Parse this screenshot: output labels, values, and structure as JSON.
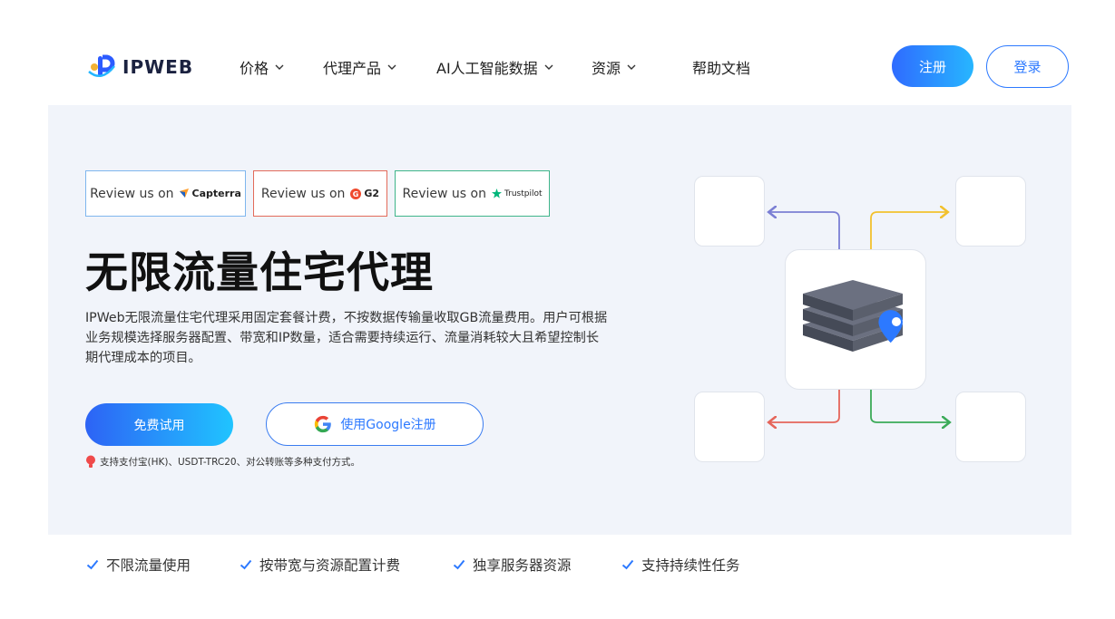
{
  "header": {
    "logo_text": "IPWEB",
    "nav": [
      {
        "label": "价格",
        "has_dropdown": true
      },
      {
        "label": "代理产品",
        "has_dropdown": true
      },
      {
        "label": "AI人工智能数据",
        "has_dropdown": true
      },
      {
        "label": "资源",
        "has_dropdown": true
      },
      {
        "label": "帮助文档",
        "has_dropdown": false
      }
    ],
    "register_label": "注册",
    "login_label": "登录"
  },
  "hero": {
    "reviews": [
      {
        "prefix": "Review us on",
        "brand": "Capterra",
        "color": "#7fb6ee"
      },
      {
        "prefix": "Review us on",
        "brand": "G2",
        "color": "#e36b5a"
      },
      {
        "prefix": "Review us on",
        "brand": "Trustpilot",
        "color": "#3fb58a"
      }
    ],
    "title": "无限流量住宅代理",
    "description": "IPWeb无限流量住宅代理采用固定套餐计费，不按数据传输量收取GB流量费用。用户可根据业务规模选择服务器配置、带宽和IP数量，适合需要持续运行、流量消耗较大且希望控制长期代理成本的项目。",
    "trial_label": "免费试用",
    "google_label": "使用Google注册",
    "payment_note": "支持支付宝(HK)、USDT-TRC20、对公转账等多种支付方式。"
  },
  "features": [
    "不限流量使用",
    "按带宽与资源配置计费",
    "独享服务器资源",
    "支持持续性任务"
  ],
  "colors": {
    "accent": "#2c79ff",
    "hero_bg": "#f1f4fa",
    "arrow_purple": "#7b7fd4",
    "arrow_yellow": "#f2c12e",
    "arrow_red": "#e5655a",
    "arrow_green": "#3caa58"
  }
}
